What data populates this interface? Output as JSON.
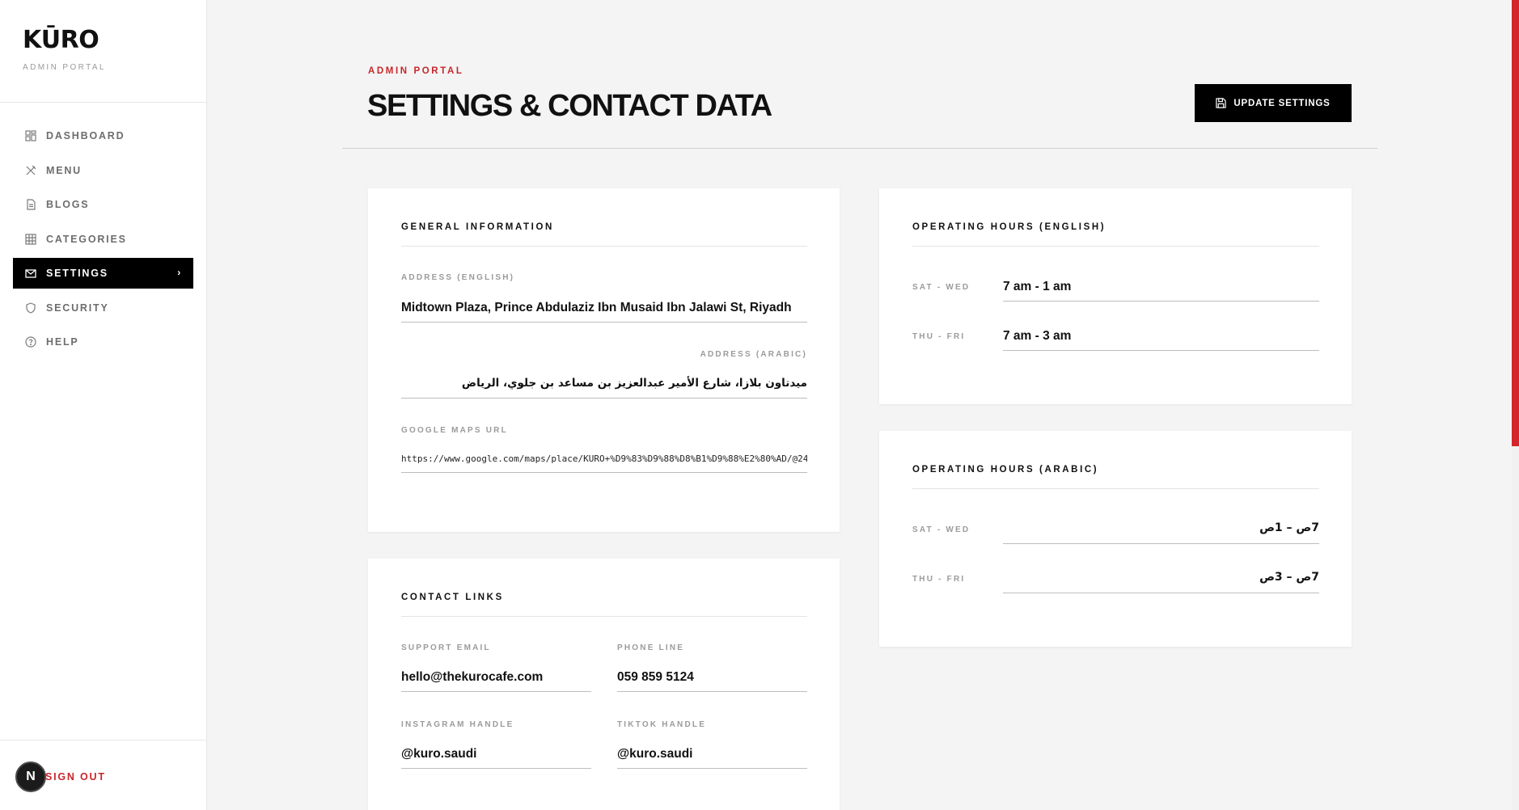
{
  "brand": {
    "logo": "KŪRO",
    "subtitle": "ADMIN PORTAL"
  },
  "sidebar": {
    "items": [
      {
        "label": "DASHBOARD",
        "icon": "dashboard-icon"
      },
      {
        "label": "MENU",
        "icon": "utensils-icon"
      },
      {
        "label": "BLOGS",
        "icon": "document-icon"
      },
      {
        "label": "CATEGORIES",
        "icon": "grid-icon"
      },
      {
        "label": "SETTINGS",
        "icon": "mail-icon",
        "active": true
      },
      {
        "label": "SECURITY",
        "icon": "shield-icon"
      },
      {
        "label": "HELP",
        "icon": "help-icon"
      }
    ],
    "signout": "SIGN OUT",
    "badge": "N"
  },
  "header": {
    "kicker": "ADMIN PORTAL",
    "title": "SETTINGS & CONTACT DATA",
    "update_label": "UPDATE SETTINGS"
  },
  "general": {
    "title": "GENERAL INFORMATION",
    "address_en_label": "ADDRESS (ENGLISH)",
    "address_en": "Midtown Plaza, Prince Abdulaziz Ibn Musaid Ibn Jalawi St, Riyadh",
    "address_ar_label": "ADDRESS (ARABIC)",
    "address_ar": "ميدتاون بلازا، شارع الأمير عبدالعزيز بن مساعد بن جلوي، الرياض",
    "maps_label": "GOOGLE MAPS URL",
    "maps_url": "https://www.google.com/maps/place/KURO+%D9%83%D9%88%D8%B1%D9%88%E2%80%AD/@24"
  },
  "contact": {
    "title": "CONTACT LINKS",
    "email_label": "SUPPORT EMAIL",
    "email": "hello@thekurocafe.com",
    "phone_label": "PHONE LINE",
    "phone": "059 859 5124",
    "instagram_label": "INSTAGRAM HANDLE",
    "instagram": "@kuro.saudi",
    "tiktok_label": "TIKTOK HANDLE",
    "tiktok": "@kuro.saudi"
  },
  "hours_en": {
    "title": "OPERATING HOURS (ENGLISH)",
    "row1_label": "SAT - WED",
    "row1_value": "7 am - 1 am",
    "row2_label": "THU - FRI",
    "row2_value": "7 am - 3 am"
  },
  "hours_ar": {
    "title": "OPERATING HOURS (ARABIC)",
    "row1_label": "SAT - WED",
    "row1_value": "7ص – 1ص",
    "row2_label": "THU - FRI",
    "row2_value": "7ص – 3ص"
  },
  "colors": {
    "accent": "#c8262b",
    "primary": "#000000",
    "background": "#f4f4f4"
  }
}
